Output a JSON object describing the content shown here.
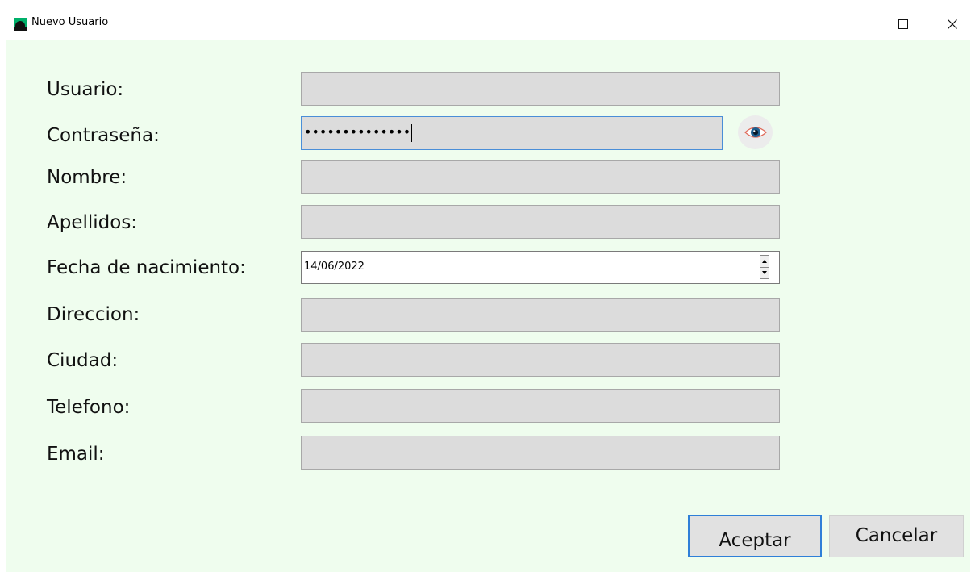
{
  "window": {
    "title": "Nuevo Usuario"
  },
  "form": {
    "usuario": {
      "label": "Usuario:",
      "value": ""
    },
    "contrasena": {
      "label": "Contraseña:",
      "masked_value": "••••••••••••••"
    },
    "nombre": {
      "label": "Nombre:",
      "value": ""
    },
    "apellidos": {
      "label": "Apellidos:",
      "value": ""
    },
    "fecha": {
      "label": "Fecha de nacimiento:",
      "value": "14/06/2022"
    },
    "direccion": {
      "label": "Direccion:",
      "value": ""
    },
    "ciudad": {
      "label": "Ciudad:",
      "value": ""
    },
    "telefono": {
      "label": "Telefono:",
      "value": ""
    },
    "email": {
      "label": "Email:",
      "value": ""
    }
  },
  "buttons": {
    "accept_label": "Aceptar",
    "cancel_label": "Cancelar"
  },
  "icons": {
    "app": "app-icon",
    "eye": "eye-icon"
  },
  "colors": {
    "form_background": "#effdee",
    "field_background": "#dcdcdc",
    "focus_border": "#2f7fd8"
  }
}
